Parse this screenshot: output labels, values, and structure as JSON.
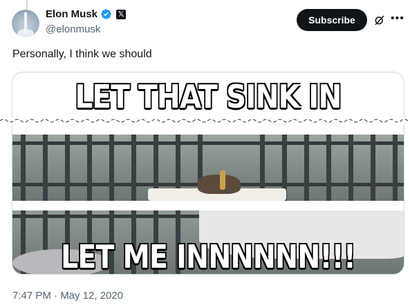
{
  "author": {
    "name": "Elon Musk",
    "handle": "@elonmusk"
  },
  "actions": {
    "subscribe_label": "Subscribe"
  },
  "tweet": {
    "text": "Personally, I think we should",
    "timestamp": "7:47 PM · May 12, 2020"
  },
  "media": {
    "caption_top": "LET THAT SINK IN",
    "caption_bottom": "LET ME INNNNNN!!!"
  },
  "icons": {
    "verified": "verified-badge-icon",
    "affiliate": "x-logo-icon",
    "grok": "grok-icon",
    "more": "more-icon"
  },
  "colors": {
    "verified_blue": "#1d9bf0",
    "subscribe_bg": "#0f1419",
    "secondary_text": "#536471",
    "card_border": "#cfd9de"
  }
}
